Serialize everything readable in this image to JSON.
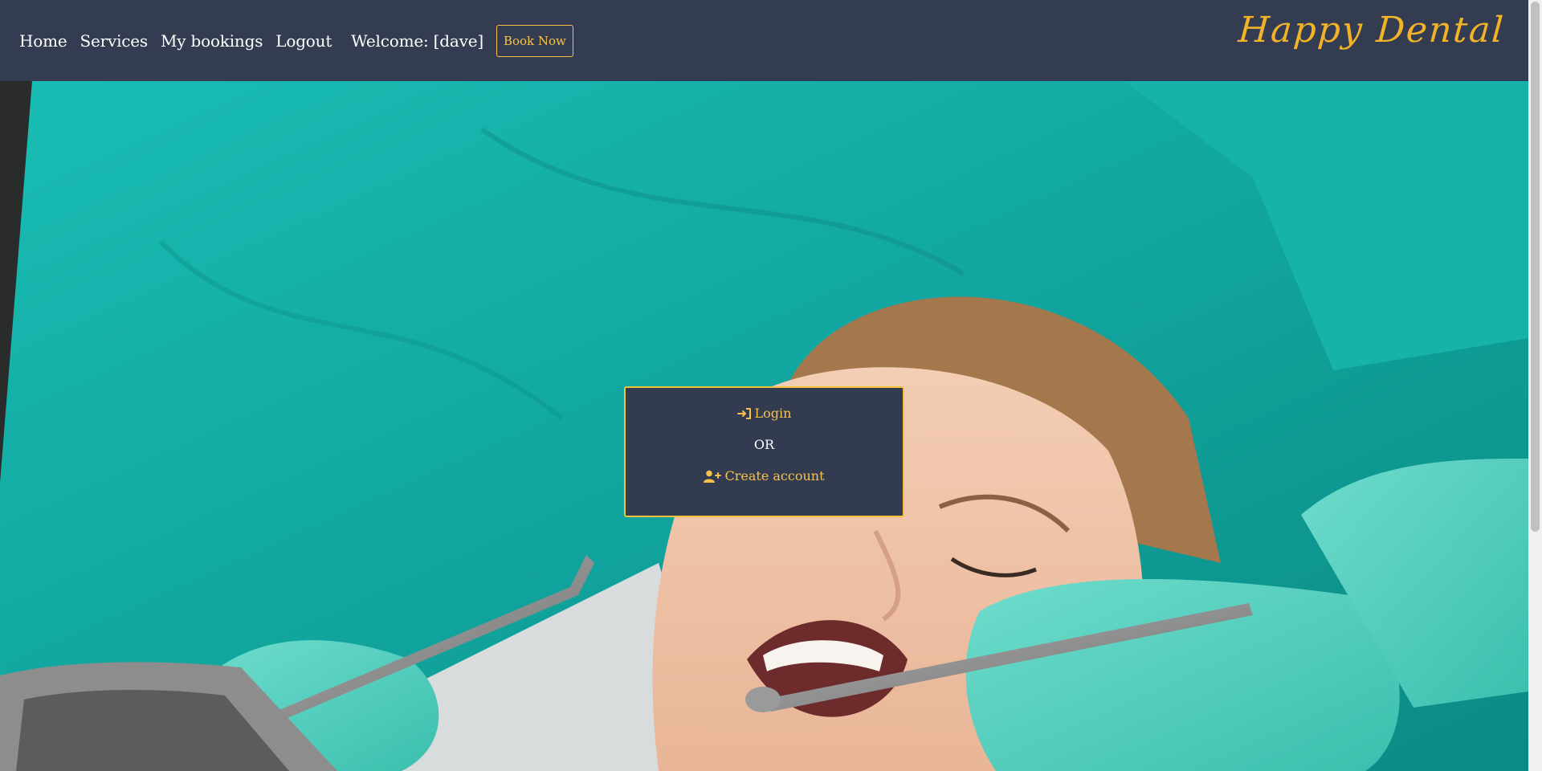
{
  "nav": {
    "links": [
      {
        "label": "Home"
      },
      {
        "label": "Services"
      },
      {
        "label": "My bookings"
      },
      {
        "label": "Logout"
      }
    ],
    "welcome": "Welcome: [dave]",
    "book_button": "Book Now",
    "brand": "Happy Dental"
  },
  "auth": {
    "login_label": "Login",
    "or_label": "OR",
    "create_label": "Create account",
    "login_icon": "login-icon",
    "create_icon": "user-plus-icon"
  },
  "hero": {
    "image_description_icon": "dental-hero-image"
  },
  "colors": {
    "navbar": "#333c51",
    "accent": "#f7c24a",
    "brand": "#f2b328",
    "scrubs": "#17b6ae",
    "glove": "#4fcfbf"
  }
}
